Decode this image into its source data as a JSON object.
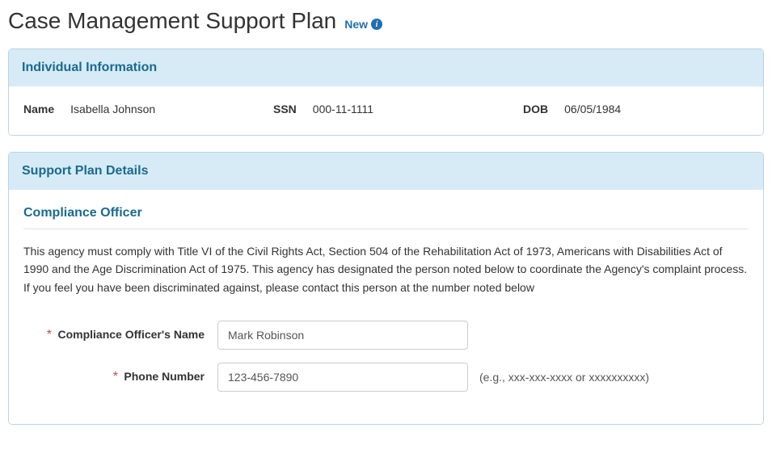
{
  "header": {
    "title": "Case Management Support Plan",
    "status": "New"
  },
  "panels": {
    "individual": {
      "title": "Individual Information",
      "name_label": "Name",
      "name_value": "Isabella Johnson",
      "ssn_label": "SSN",
      "ssn_value": "000-11-1111",
      "dob_label": "DOB",
      "dob_value": "06/05/1984"
    },
    "support": {
      "title": "Support Plan Details",
      "section": {
        "title": "Compliance Officer",
        "text": "This agency must comply with Title VI of the Civil Rights Act, Section 504 of the Rehabilitation Act of 1973, Americans with Disabilities Act of 1990 and the Age Discrimination Act of 1975. This agency has designated the person noted below to coordinate the Agency's complaint process. If you feel you have been discriminated against, please contact this person at the number noted below",
        "officer_name_label": "Compliance Officer's Name",
        "officer_name_value": "Mark Robinson",
        "phone_label": "Phone Number",
        "phone_value": "123-456-7890",
        "phone_hint": "(e.g., xxx-xxx-xxxx or xxxxxxxxxx)"
      }
    }
  }
}
